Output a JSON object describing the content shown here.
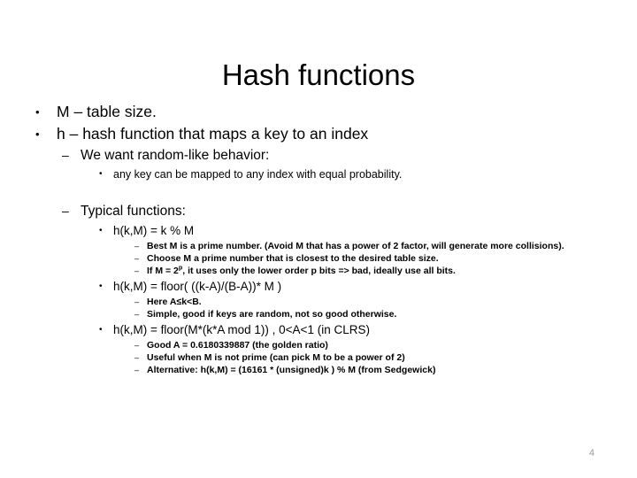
{
  "slide": {
    "title": "Hash functions",
    "page_number": "4",
    "bullets": {
      "b1": "M – table size.",
      "b2": "h – hash function that maps a key to an index",
      "b2_1": "We want random-like behavior:",
      "b2_1_1": "any key can be mapped to any index with equal probability.",
      "b2_2": "Typical functions:",
      "f1": "h(k,M) = k % M",
      "f1_1_pre": "Best M is a prime number. (Avoid M that has a power of 2 factor, will generate more collisions).",
      "f1_2": "Choose M a prime number that is closest to the desired table size.",
      "f1_3_a": "If M = 2",
      "f1_3_sup": "p",
      "f1_3_b": ", it uses only the lower order p bits => bad, ideally use all bits.",
      "f2": "h(k,M) = floor( ((k-A)/(B-A))* M )",
      "f2_1": "Here A≤k<B.",
      "f2_2": "Simple, good if keys are random, not so good otherwise.",
      "f3": "h(k,M) = floor(M*(k*A mod 1)) ,   0<A<1  (in CLRS)",
      "f3_1": "Good A = 0.6180339887 (the golden ratio)",
      "f3_2": "Useful when M is not prime (can pick M to be a power of 2)",
      "f3_3": "Alternative: h(k,M) = (16161 * (unsigned)k ) % M     (from Sedgewick)"
    },
    "markers": {
      "dot": "•",
      "dash": "–"
    },
    "colors": {
      "text": "#000000",
      "background": "#ffffff",
      "page_number": "#9a9a9a"
    }
  }
}
